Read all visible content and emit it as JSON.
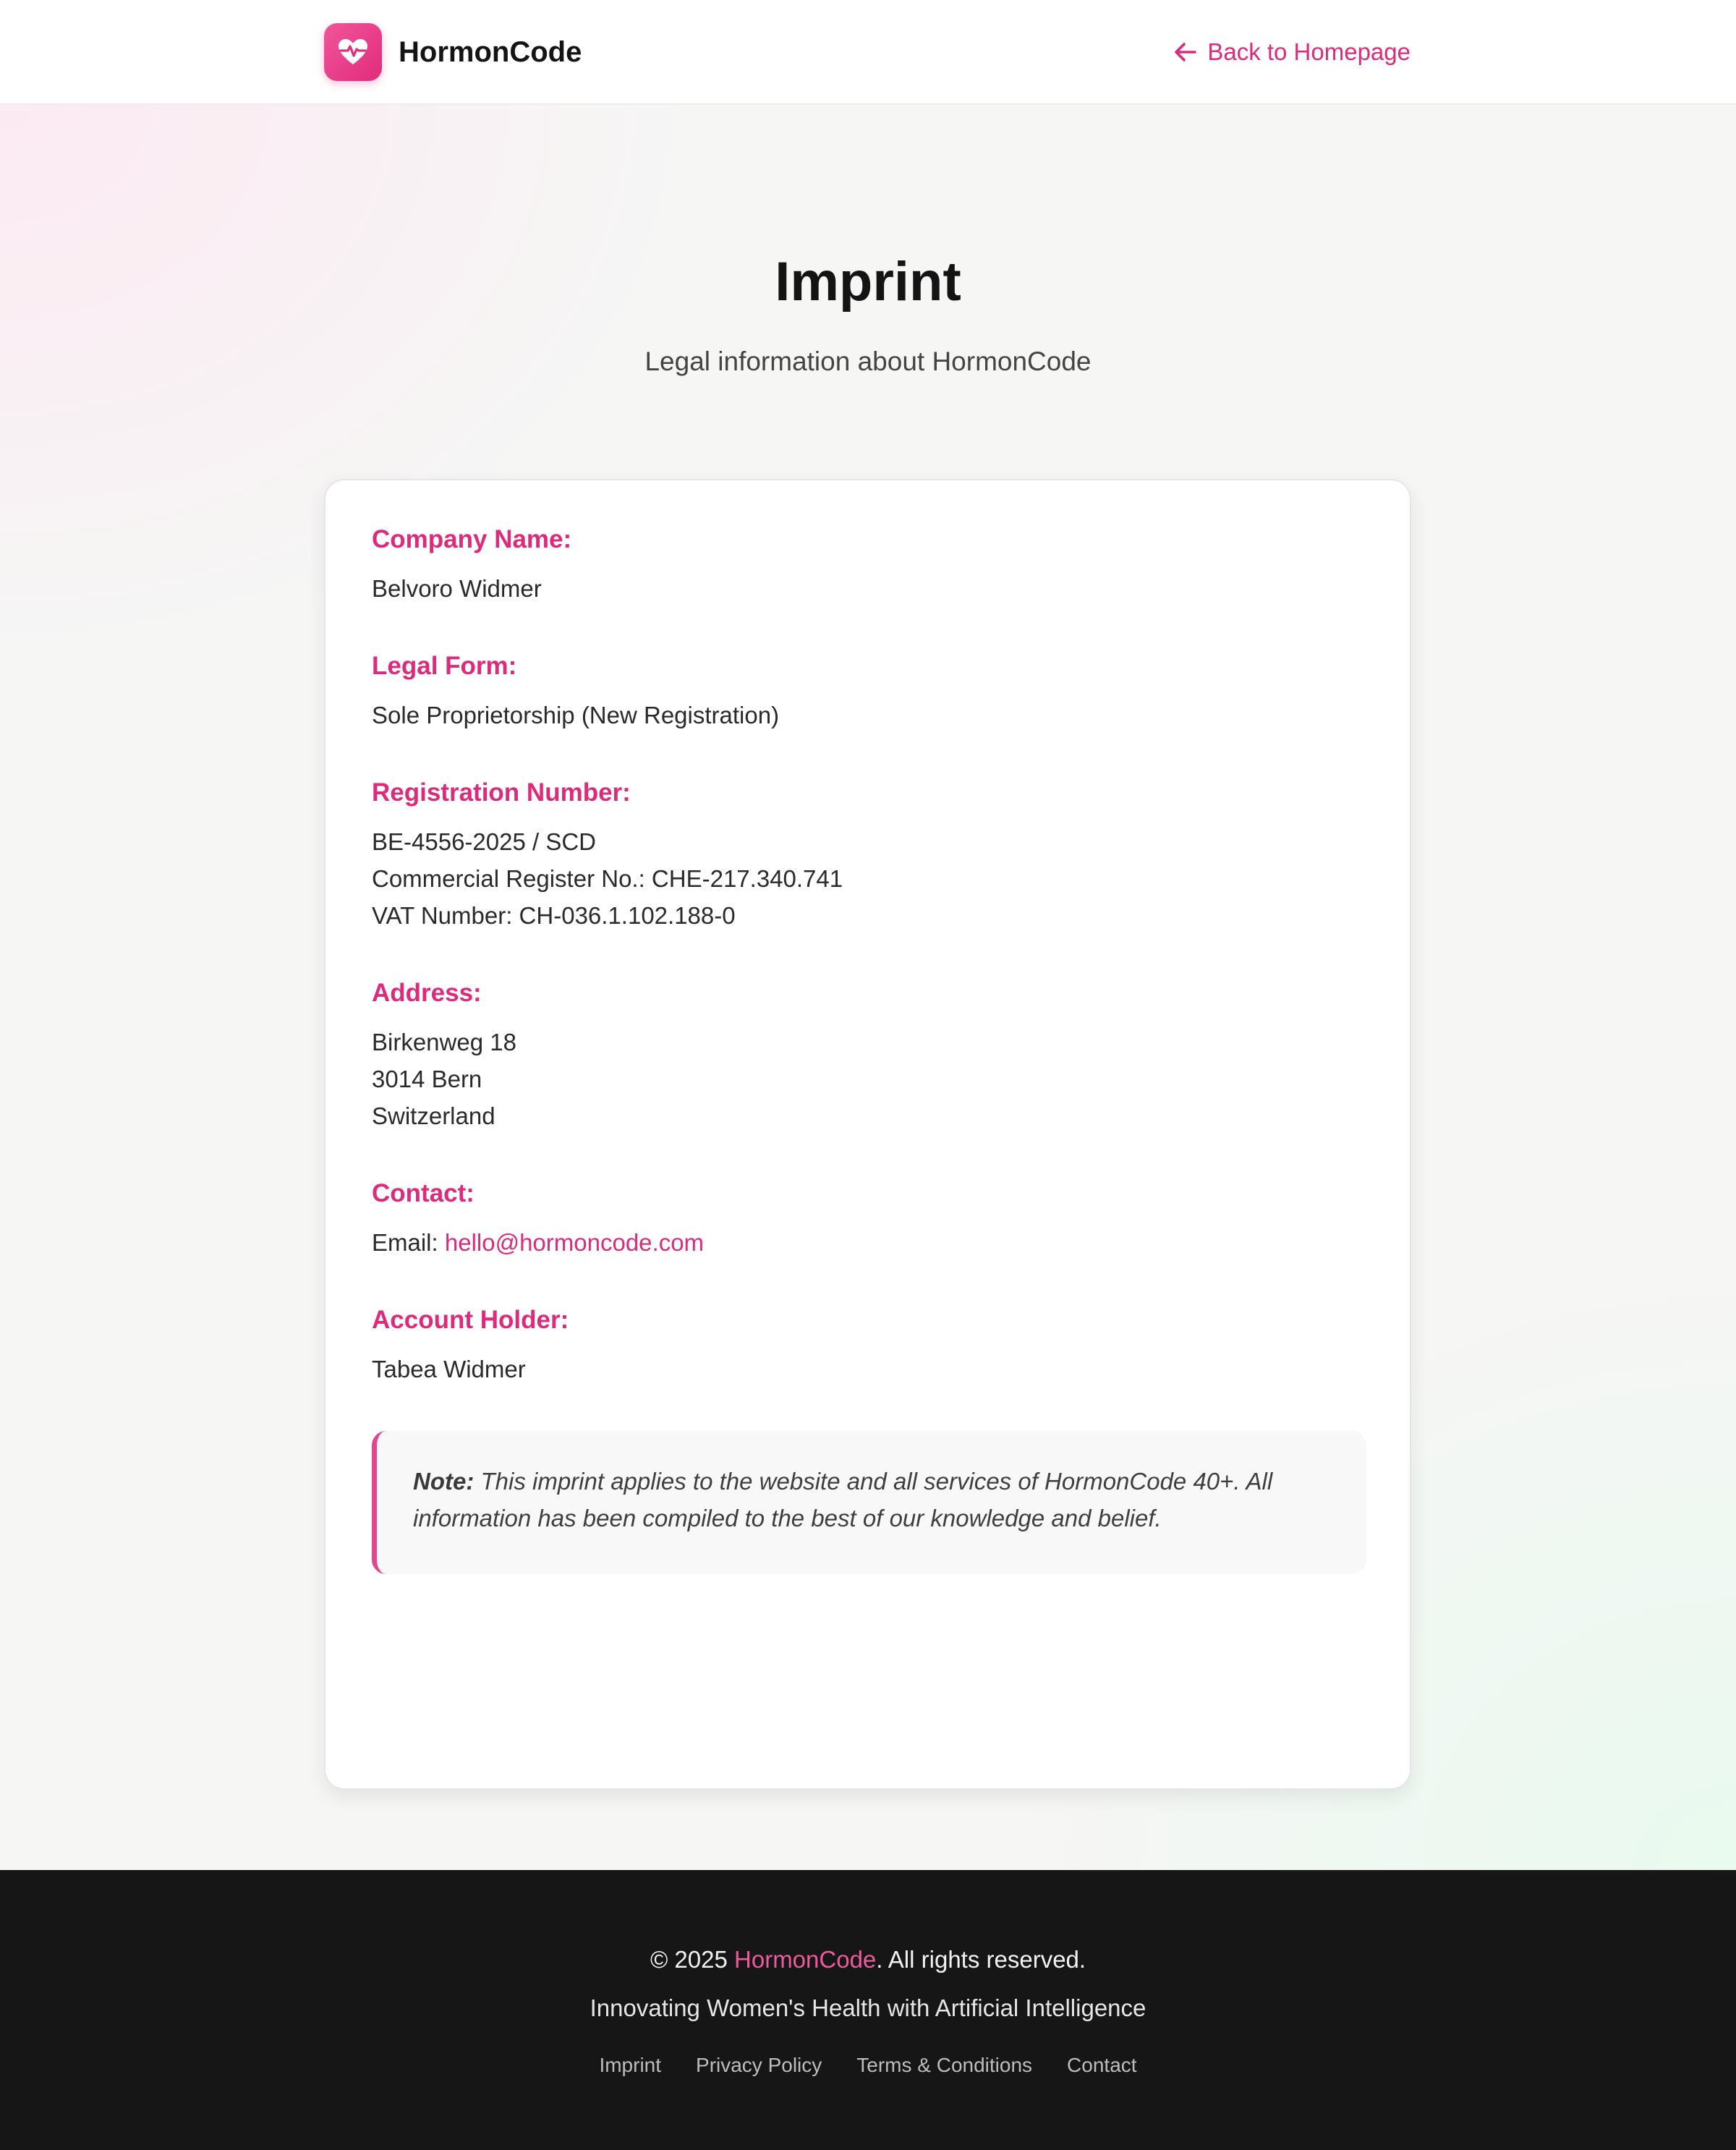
{
  "header": {
    "brand": "HormonCode",
    "back_label": "Back to Homepage"
  },
  "hero": {
    "title": "Imprint",
    "subtitle": "Legal information about HormonCode"
  },
  "sections": [
    {
      "heading": "Company Name:",
      "lines": [
        "Belvoro Widmer"
      ]
    },
    {
      "heading": "Legal Form:",
      "lines": [
        "Sole Proprietorship (New Registration)"
      ]
    },
    {
      "heading": "Registration Number:",
      "lines": [
        "BE-4556-2025 / SCD",
        "Commercial Register No.: CHE-217.340.741",
        "VAT Number: CH-036.1.102.188-0"
      ]
    },
    {
      "heading": "Address:",
      "lines": [
        "Birkenweg 18",
        "3014 Bern",
        "Switzerland"
      ]
    },
    {
      "heading": "Contact:",
      "email_prefix": "Email: ",
      "email": "hello@hormoncode.com"
    },
    {
      "heading": "Account Holder:",
      "lines": [
        "Tabea Widmer"
      ]
    }
  ],
  "note": {
    "label": "Note:",
    "text": " This imprint applies to the website and all services of HormonCode 40+. All information has been compiled to the best of our knowledge and belief."
  },
  "footer": {
    "copy_prefix": "© 2025 ",
    "copy_brand": "HormonCode",
    "copy_suffix": ". All rights reserved.",
    "tagline": "Innovating Women's Health with Artificial Intelligence",
    "links": [
      "Imprint",
      "Privacy Policy",
      "Terms & Conditions",
      "Contact"
    ]
  },
  "colors": {
    "accent": "#dd2a7b",
    "footer_bg": "#161616"
  },
  "icons": {
    "logo": "heart-pulse-icon",
    "back": "arrow-left-icon"
  }
}
